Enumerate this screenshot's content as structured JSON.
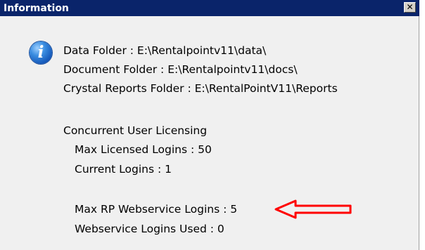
{
  "dialog": {
    "title": "Information",
    "close_label": "✕",
    "icon": "information-icon",
    "icon_glyph": "i",
    "folders": {
      "data_folder": "Data Folder : E:\\Rentalpointv11\\data\\",
      "document_folder": "Document Folder : E:\\Rentalpointv11\\docs\\",
      "crystal_reports_folder": "Crystal Reports Folder : E:\\RentalPointV11\\Reports"
    },
    "licensing": {
      "heading": "Concurrent User Licensing",
      "max_licensed_logins": "Max Licensed Logins : 50",
      "current_logins": "Current Logins : 1"
    },
    "webservice": {
      "max_rp_webservice_logins": "Max RP Webservice Logins : 5",
      "webservice_logins_used": "Webservice Logins Used : 0"
    }
  },
  "annotation": {
    "arrow_color": "#ff0000"
  },
  "colors": {
    "titlebar": "#0a246a",
    "dialog_bg": "#f0f0f0"
  }
}
